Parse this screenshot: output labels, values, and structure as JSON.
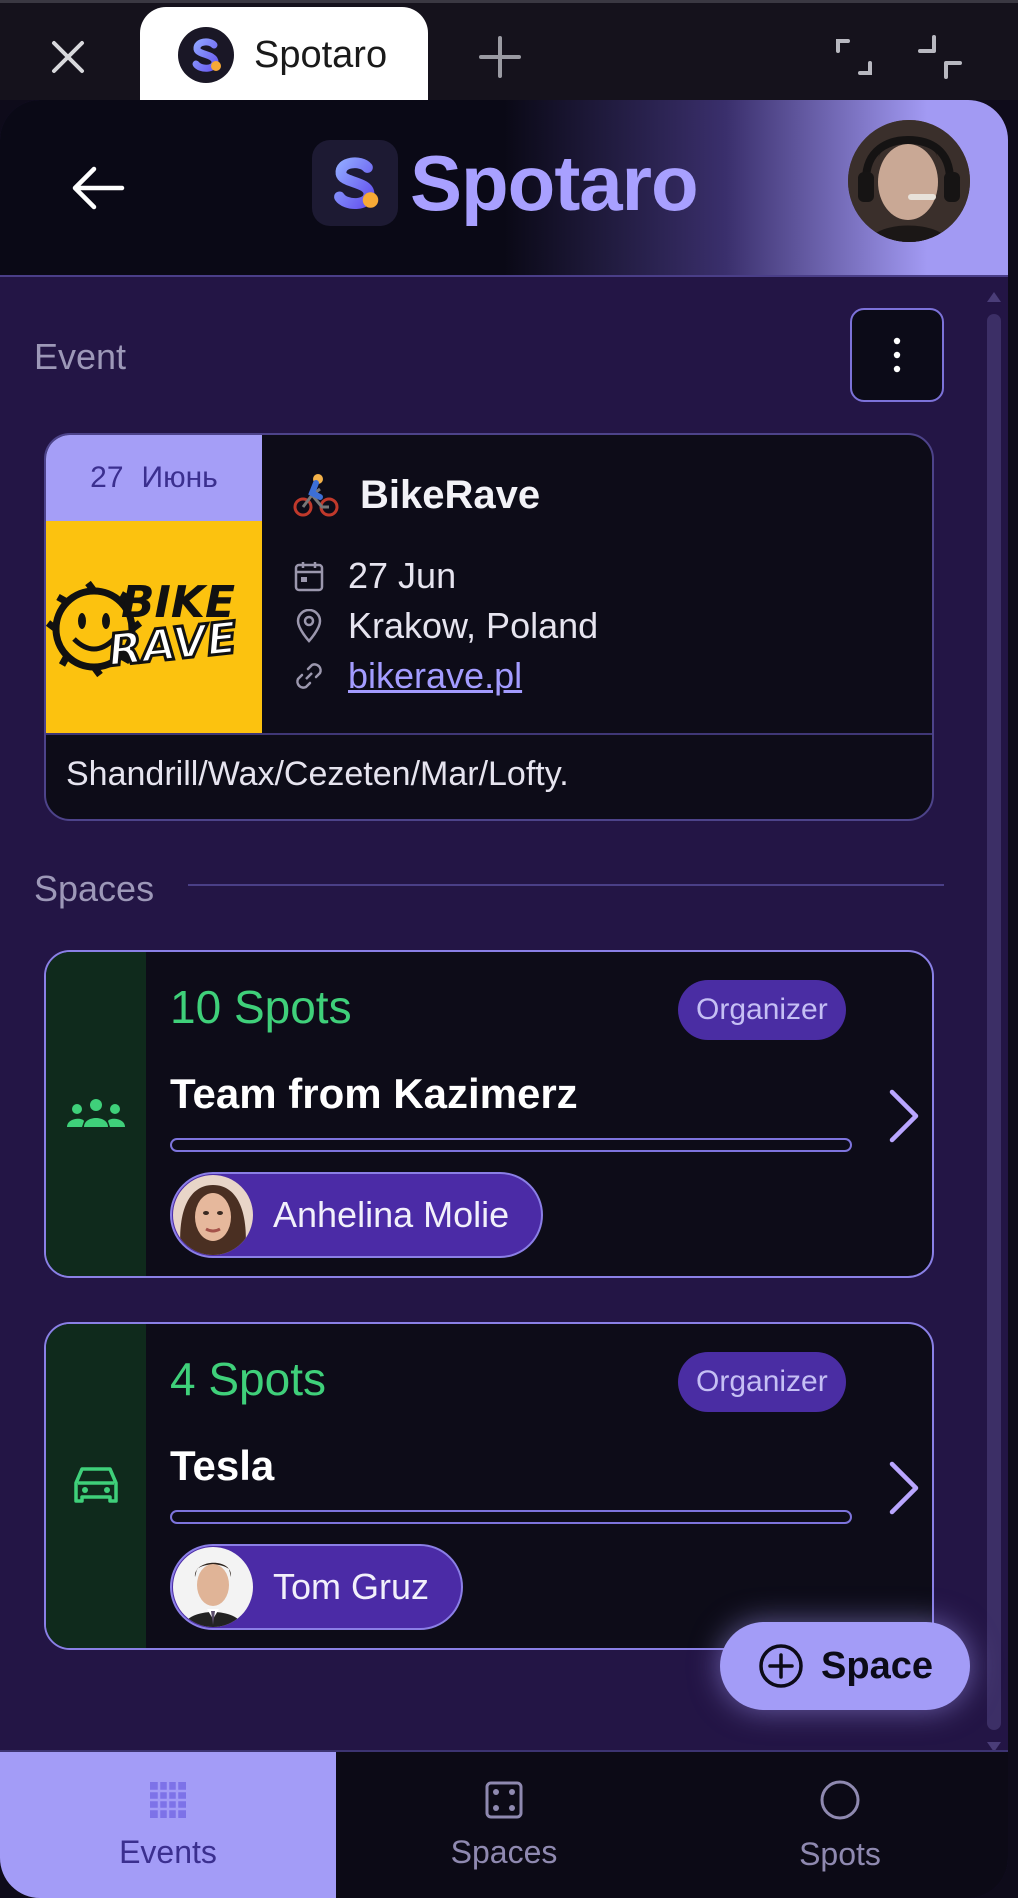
{
  "browser": {
    "tab_title": "Spotaro"
  },
  "header": {
    "brand_name": "Spotaro"
  },
  "event_section": {
    "label": "Event",
    "card": {
      "date_day": "27",
      "date_month": "Июнь",
      "title": "BikeRave",
      "date": "27 Jun",
      "location": "Krakow, Poland",
      "link": "bikerave.pl",
      "description": "Shandrill/Wax/Cezeten/Mar/Lofty.",
      "poster_text_top": "BIKE",
      "poster_text_bottom": "RAVE"
    }
  },
  "spaces_section": {
    "label": "Spaces",
    "items": [
      {
        "spots": "10 Spots",
        "role": "Organizer",
        "name": "Team from Kazimerz",
        "member": "Anhelina Molie",
        "icon": "group-icon",
        "progress": 0
      },
      {
        "spots": "4 Spots",
        "role": "Organizer",
        "name": "Tesla",
        "member": "Tom Gruz",
        "icon": "car-icon",
        "progress": 0
      }
    ]
  },
  "fab": {
    "label": "Space"
  },
  "bottom_nav": {
    "items": [
      {
        "label": "Events",
        "active": true
      },
      {
        "label": "Spaces",
        "active": false
      },
      {
        "label": "Spots",
        "active": false
      }
    ]
  },
  "colors": {
    "accent": "#a39cf7",
    "background": "#231545",
    "spots_green": "#3fd07a",
    "badge": "#4a2da3"
  }
}
